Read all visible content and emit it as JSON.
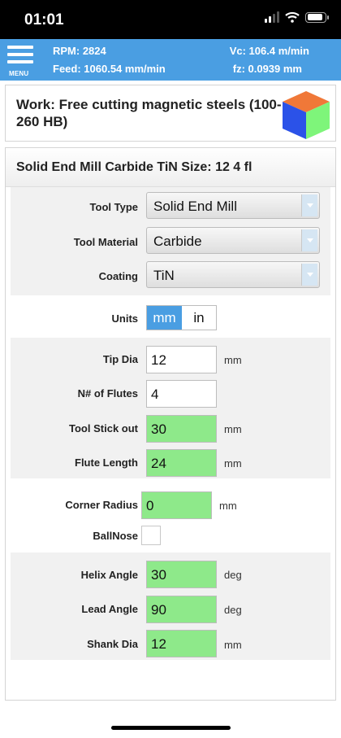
{
  "status_bar": {
    "time": "01:01"
  },
  "header": {
    "menu_label": "MENU",
    "rpm": "RPM: 2824",
    "vc": "Vc: 106.4 m/min",
    "feed": "Feed: 1060.54 mm/min",
    "fz": "fz: 0.0939 mm"
  },
  "work": {
    "title": "Work: Free cutting magnetic steels (100-260 HB)",
    "cube_colors": {
      "top": "#f07838",
      "left": "#2b52e8",
      "right": "#7ef57a"
    }
  },
  "tool_panel": {
    "title": "Solid End Mill Carbide TiN Size: 12 4 fl",
    "tool_type": {
      "label": "Tool Type",
      "value": "Solid End Mill"
    },
    "tool_material": {
      "label": "Tool Material",
      "value": "Carbide"
    },
    "coating": {
      "label": "Coating",
      "value": "TiN"
    },
    "units": {
      "label": "Units",
      "options": [
        "mm",
        "in"
      ],
      "selected": "mm"
    },
    "tip_dia": {
      "label": "Tip Dia",
      "value": "12",
      "unit": "mm"
    },
    "flutes": {
      "label": "N# of Flutes",
      "value": "4"
    },
    "stick_out": {
      "label": "Tool Stick out",
      "value": "30",
      "unit": "mm"
    },
    "flute_length": {
      "label": "Flute Length",
      "value": "24",
      "unit": "mm"
    },
    "corner_radius": {
      "label": "Corner Radius",
      "value": "0",
      "unit": "mm"
    },
    "ballnose": {
      "label": "BallNose",
      "checked": false
    },
    "helix_angle": {
      "label": "Helix Angle",
      "value": "30",
      "unit": "deg"
    },
    "lead_angle": {
      "label": "Lead Angle",
      "value": "90",
      "unit": "deg"
    },
    "shank_dia": {
      "label": "Shank Dia",
      "value": "12",
      "unit": "mm"
    }
  },
  "colors": {
    "header_blue": "#4a9ee2",
    "input_green": "#8ee98a",
    "group_gray": "#f1f1f1"
  }
}
